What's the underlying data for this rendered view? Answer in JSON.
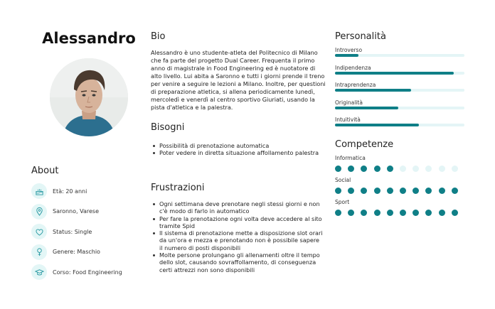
{
  "profile": {
    "name": "Alessandro"
  },
  "about": {
    "title": "About",
    "items": [
      {
        "icon": "cake-icon",
        "text": "Età: 20 anni"
      },
      {
        "icon": "location-pin-icon",
        "text": "Saronno,  Varese"
      },
      {
        "icon": "heart-icon",
        "text": "Status: Single"
      },
      {
        "icon": "gender-icon",
        "text": "Genere: Maschio"
      },
      {
        "icon": "graduation-cap-icon",
        "text": "Corso: Food Engineering"
      }
    ]
  },
  "bio": {
    "title": "Bio",
    "text": "Alessandro è uno studente-atleta del Politecnico di Milano che fa parte del progetto Dual Career. Frequenta il primo anno di magistrale in Food Engineering ed è nuotatore di alto livello. Lui abita a Saronno e tutti i giorni prende il treno per venire a seguire le lezioni a Milano. Inoltre, per questioni di preparazione atletica, si allena periodicamente lunedì, mercoledì e venerdì al centro sportivo Giuriati, usando la pista d'atletica e la palestra."
  },
  "needs": {
    "title": "Bisogni",
    "items": [
      "Possibilità di prenotazione automatica",
      "Poter vedere in diretta situazione affollamento palestra"
    ]
  },
  "frustrations": {
    "title": "Frustrazioni",
    "items": [
      "Ogni settimana deve prenotare negli stessi giorni e non c'è modo di farlo in automatico",
      "Per fare la prenotazione ogni volta deve accedere al sito tramite Spid",
      "Il sistema di prenotazione mette a disposizione slot orari da un'ora e mezza e prenotando non è possibile sapere il numero di posti disponibili",
      "Molte persone prolungano gli allenamenti oltre il tempo dello slot, causando sovraffollamento, di conseguenza certi attrezzi non sono disponibili"
    ]
  },
  "personality": {
    "title": "Personalità",
    "traits": [
      {
        "label": "Introverso",
        "level": 0.18
      },
      {
        "label": "Indipendenza",
        "level": 0.92
      },
      {
        "label": "Intraprendenza",
        "level": 0.59
      },
      {
        "label": "Originalità",
        "level": 0.49
      },
      {
        "label": "Intuitività",
        "level": 0.65
      }
    ]
  },
  "skills": {
    "title": "Competenze",
    "max": 10,
    "items": [
      {
        "label": "Informatica",
        "level": 5
      },
      {
        "label": "Social",
        "level": 10
      },
      {
        "label": "Sport",
        "level": 10
      }
    ]
  },
  "colors": {
    "accent": "#0f7f87",
    "track": "#e4f5f6",
    "icon_bg": "#e3f6f6"
  }
}
